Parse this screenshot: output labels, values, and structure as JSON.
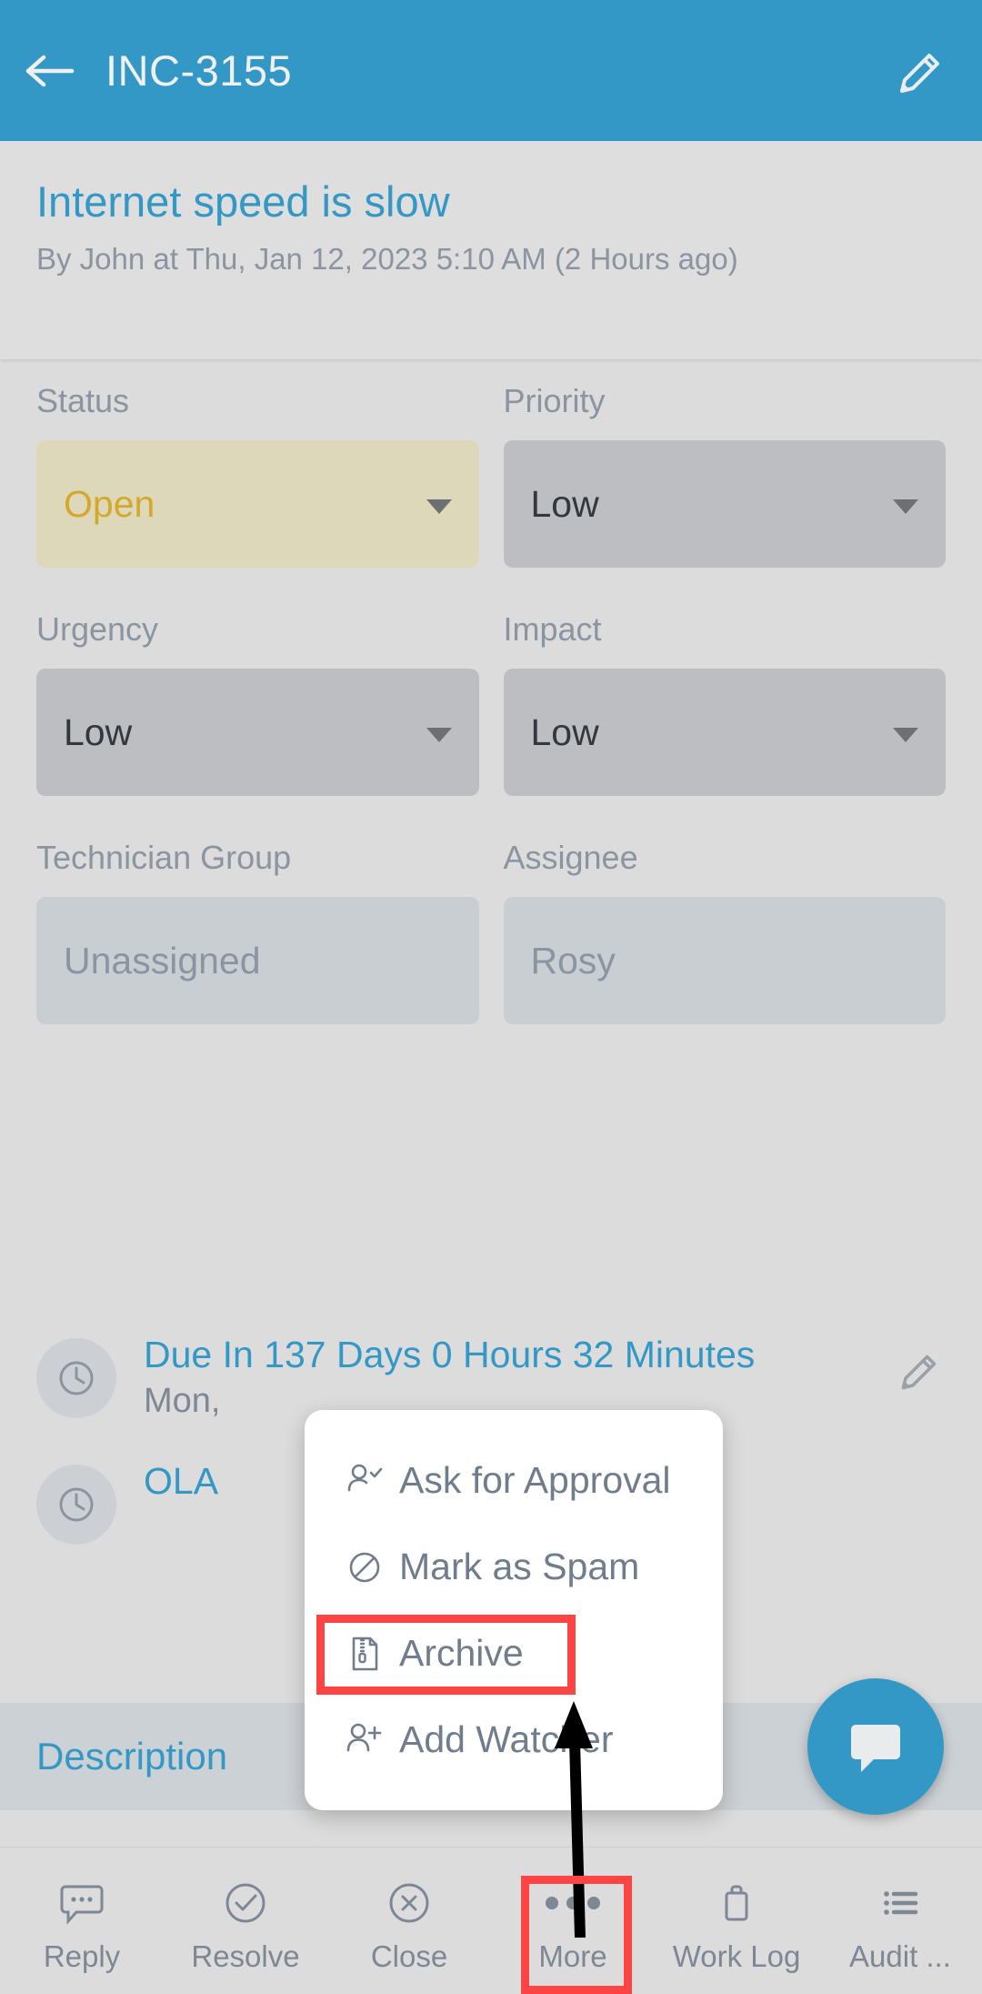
{
  "colors": {
    "header_blue": "#3398c5",
    "page_bg": "#dcdcdc",
    "status_field_bg": "#ded8bb",
    "status_text": "#d3a82c",
    "field_bg": "#bcbec1",
    "readonly_field_bg": "#c9ced3",
    "muted_text": "#8b95a1",
    "highlight_red": "#fc4444",
    "desc_bar_bg": "#ccd1d6"
  },
  "header": {
    "back_icon": "arrow-left-icon",
    "title": "INC-3155",
    "edit_icon": "pencil-icon"
  },
  "summary": {
    "title": "Internet speed is slow",
    "byline": "By John at Thu, Jan 12, 2023 5:10 AM (2 Hours ago)"
  },
  "fields": [
    [
      {
        "label": "Status",
        "value": "Open",
        "style": "status",
        "has_caret": true
      },
      {
        "label": "Priority",
        "value": "Low",
        "style": "normal",
        "has_caret": true
      }
    ],
    [
      {
        "label": "Urgency",
        "value": "Low",
        "style": "normal",
        "has_caret": true
      },
      {
        "label": "Impact",
        "value": "Low",
        "style": "normal",
        "has_caret": true
      }
    ],
    [
      {
        "label": "Technician Group",
        "value": "Unassigned",
        "style": "readonly",
        "has_caret": false
      },
      {
        "label": "Assignee",
        "value": "Rosy",
        "style": "readonly",
        "has_caret": false
      }
    ]
  ],
  "sla": [
    {
      "icon": "clock-icon",
      "main": "Due In 137 Days 0 Hours 32 Minutes",
      "date": "Mon,",
      "edit_icon": "pencil-icon"
    },
    {
      "icon": "clock-icon",
      "main": "OLA ",
      "date": "",
      "edit_icon": ""
    }
  ],
  "description_tab": {
    "label": "Description"
  },
  "fab": {
    "icon": "chat-bubble-icon"
  },
  "popup_menu": {
    "items": [
      {
        "label": "Ask for Approval",
        "icon": "person-check-icon",
        "highlighted": false
      },
      {
        "label": "Mark as Spam",
        "icon": "ban-icon",
        "highlighted": false
      },
      {
        "label": "Archive",
        "icon": "zip-file-icon",
        "highlighted": true
      },
      {
        "label": "Add Watcher",
        "icon": "person-plus-icon",
        "highlighted": false
      }
    ]
  },
  "bottom_nav": {
    "items": [
      {
        "label": "Reply",
        "icon": "comment-dots-icon",
        "highlighted": false
      },
      {
        "label": "Resolve",
        "icon": "check-circle-icon",
        "highlighted": false
      },
      {
        "label": "Close",
        "icon": "x-circle-icon",
        "highlighted": false
      },
      {
        "label": "More",
        "icon": "ellipsis-icon",
        "highlighted": true
      },
      {
        "label": "Work Log",
        "icon": "briefcase-icon",
        "highlighted": false
      },
      {
        "label": "Audit ...",
        "icon": "list-icon",
        "highlighted": false
      }
    ]
  }
}
